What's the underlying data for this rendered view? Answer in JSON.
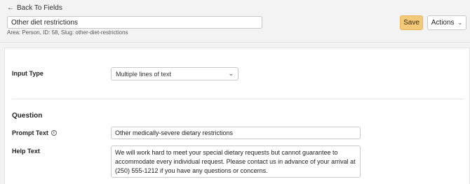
{
  "header": {
    "back_label": "Back To Fields",
    "field_name": "Other diet restrictions",
    "meta": "Area: Person, ID: 58, Slug: other-diet-restrictions",
    "save_label": "Save",
    "actions_label": "Actions"
  },
  "form": {
    "input_type_label": "Input Type",
    "input_type_value": "Multiple lines of text",
    "question_heading": "Question",
    "prompt_label": "Prompt Text",
    "prompt_value": "Other medically-severe dietary restrictions",
    "help_label": "Help Text",
    "help_value": "We will work hard to meet your special dietary requests but cannot guarantee to accommodate every individual request. Please contact us in advance of your arrival at (250) 555-1212 if you have any questions or concerns."
  },
  "colors": {
    "save_bg": "#f5c97a",
    "page_bg": "#f3f3f3"
  },
  "icons": {
    "back": "arrow-left-icon",
    "actions": "chevron-down-icon",
    "select": "chevron-down-icon",
    "prompt_info": "info-icon"
  }
}
